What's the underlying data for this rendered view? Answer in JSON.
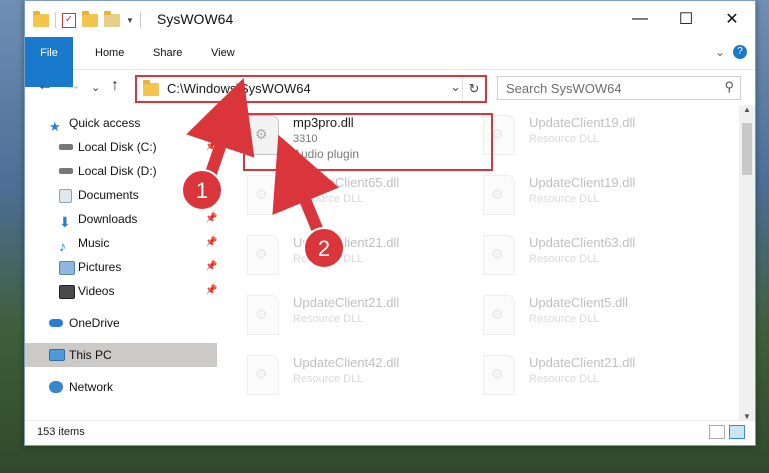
{
  "window": {
    "title": "SysWOW64",
    "minimize": "—",
    "maximize": "☐",
    "close": "✕"
  },
  "ribbon": {
    "tabs": [
      "File",
      "Home",
      "Share",
      "View"
    ],
    "expand": "⌄",
    "help": "?"
  },
  "nav": {
    "back": "←",
    "forward": "→",
    "recent": "⌄",
    "up": "↑",
    "address": "C:\\Windows\\SysWOW64",
    "dropdown": "⌄",
    "refresh": "↻",
    "search_placeholder": "Search SysWOW64",
    "search_icon": "🔍"
  },
  "sidebar": [
    {
      "label": "Quick access",
      "icon": "star-icon",
      "pinned": false
    },
    {
      "label": "Local Disk (C:)",
      "icon": "drive-icon",
      "pinned": true
    },
    {
      "label": "Local Disk (D:)",
      "icon": "drive-icon",
      "pinned": false
    },
    {
      "label": "Documents",
      "icon": "documents-icon",
      "pinned": true
    },
    {
      "label": "Downloads",
      "icon": "downloads-icon",
      "pinned": true
    },
    {
      "label": "Music",
      "icon": "music-icon",
      "pinned": true
    },
    {
      "label": "Pictures",
      "icon": "pictures-icon",
      "pinned": true
    },
    {
      "label": "Videos",
      "icon": "videos-icon",
      "pinned": true
    },
    {
      "label": "OneDrive",
      "icon": "cloud-icon",
      "pinned": false
    },
    {
      "label": "This PC",
      "icon": "computer-icon",
      "pinned": false,
      "selected": true
    },
    {
      "label": "Network",
      "icon": "network-icon",
      "pinned": false
    }
  ],
  "files": [
    {
      "name": "mp3pro.dll",
      "line1": "3310",
      "line2": "Audio plugin",
      "highlighted": true
    },
    {
      "name": "UpdateClient19.dll",
      "line1": "Resource DLL"
    },
    {
      "name": "UpdateClient65.dll",
      "line1": "Resource DLL"
    },
    {
      "name": "UpdateClient19.dll",
      "line1": "Resource DLL"
    },
    {
      "name": "UpdateClient21.dll",
      "line1": "Resource DLL"
    },
    {
      "name": "UpdateClient63.dll",
      "line1": "Resource DLL"
    },
    {
      "name": "UpdateClient21.dll",
      "line1": "Resource DLL"
    },
    {
      "name": "UpdateClient5.dll",
      "line1": "Resource DLL"
    },
    {
      "name": "UpdateClient42.dll",
      "line1": "Resource DLL"
    },
    {
      "name": "UpdateClient21.dll",
      "line1": "Resource DLL"
    }
  ],
  "status": {
    "count": "153 items"
  },
  "annotations": {
    "step1": "1",
    "step2": "2",
    "color": "#d9353b"
  }
}
